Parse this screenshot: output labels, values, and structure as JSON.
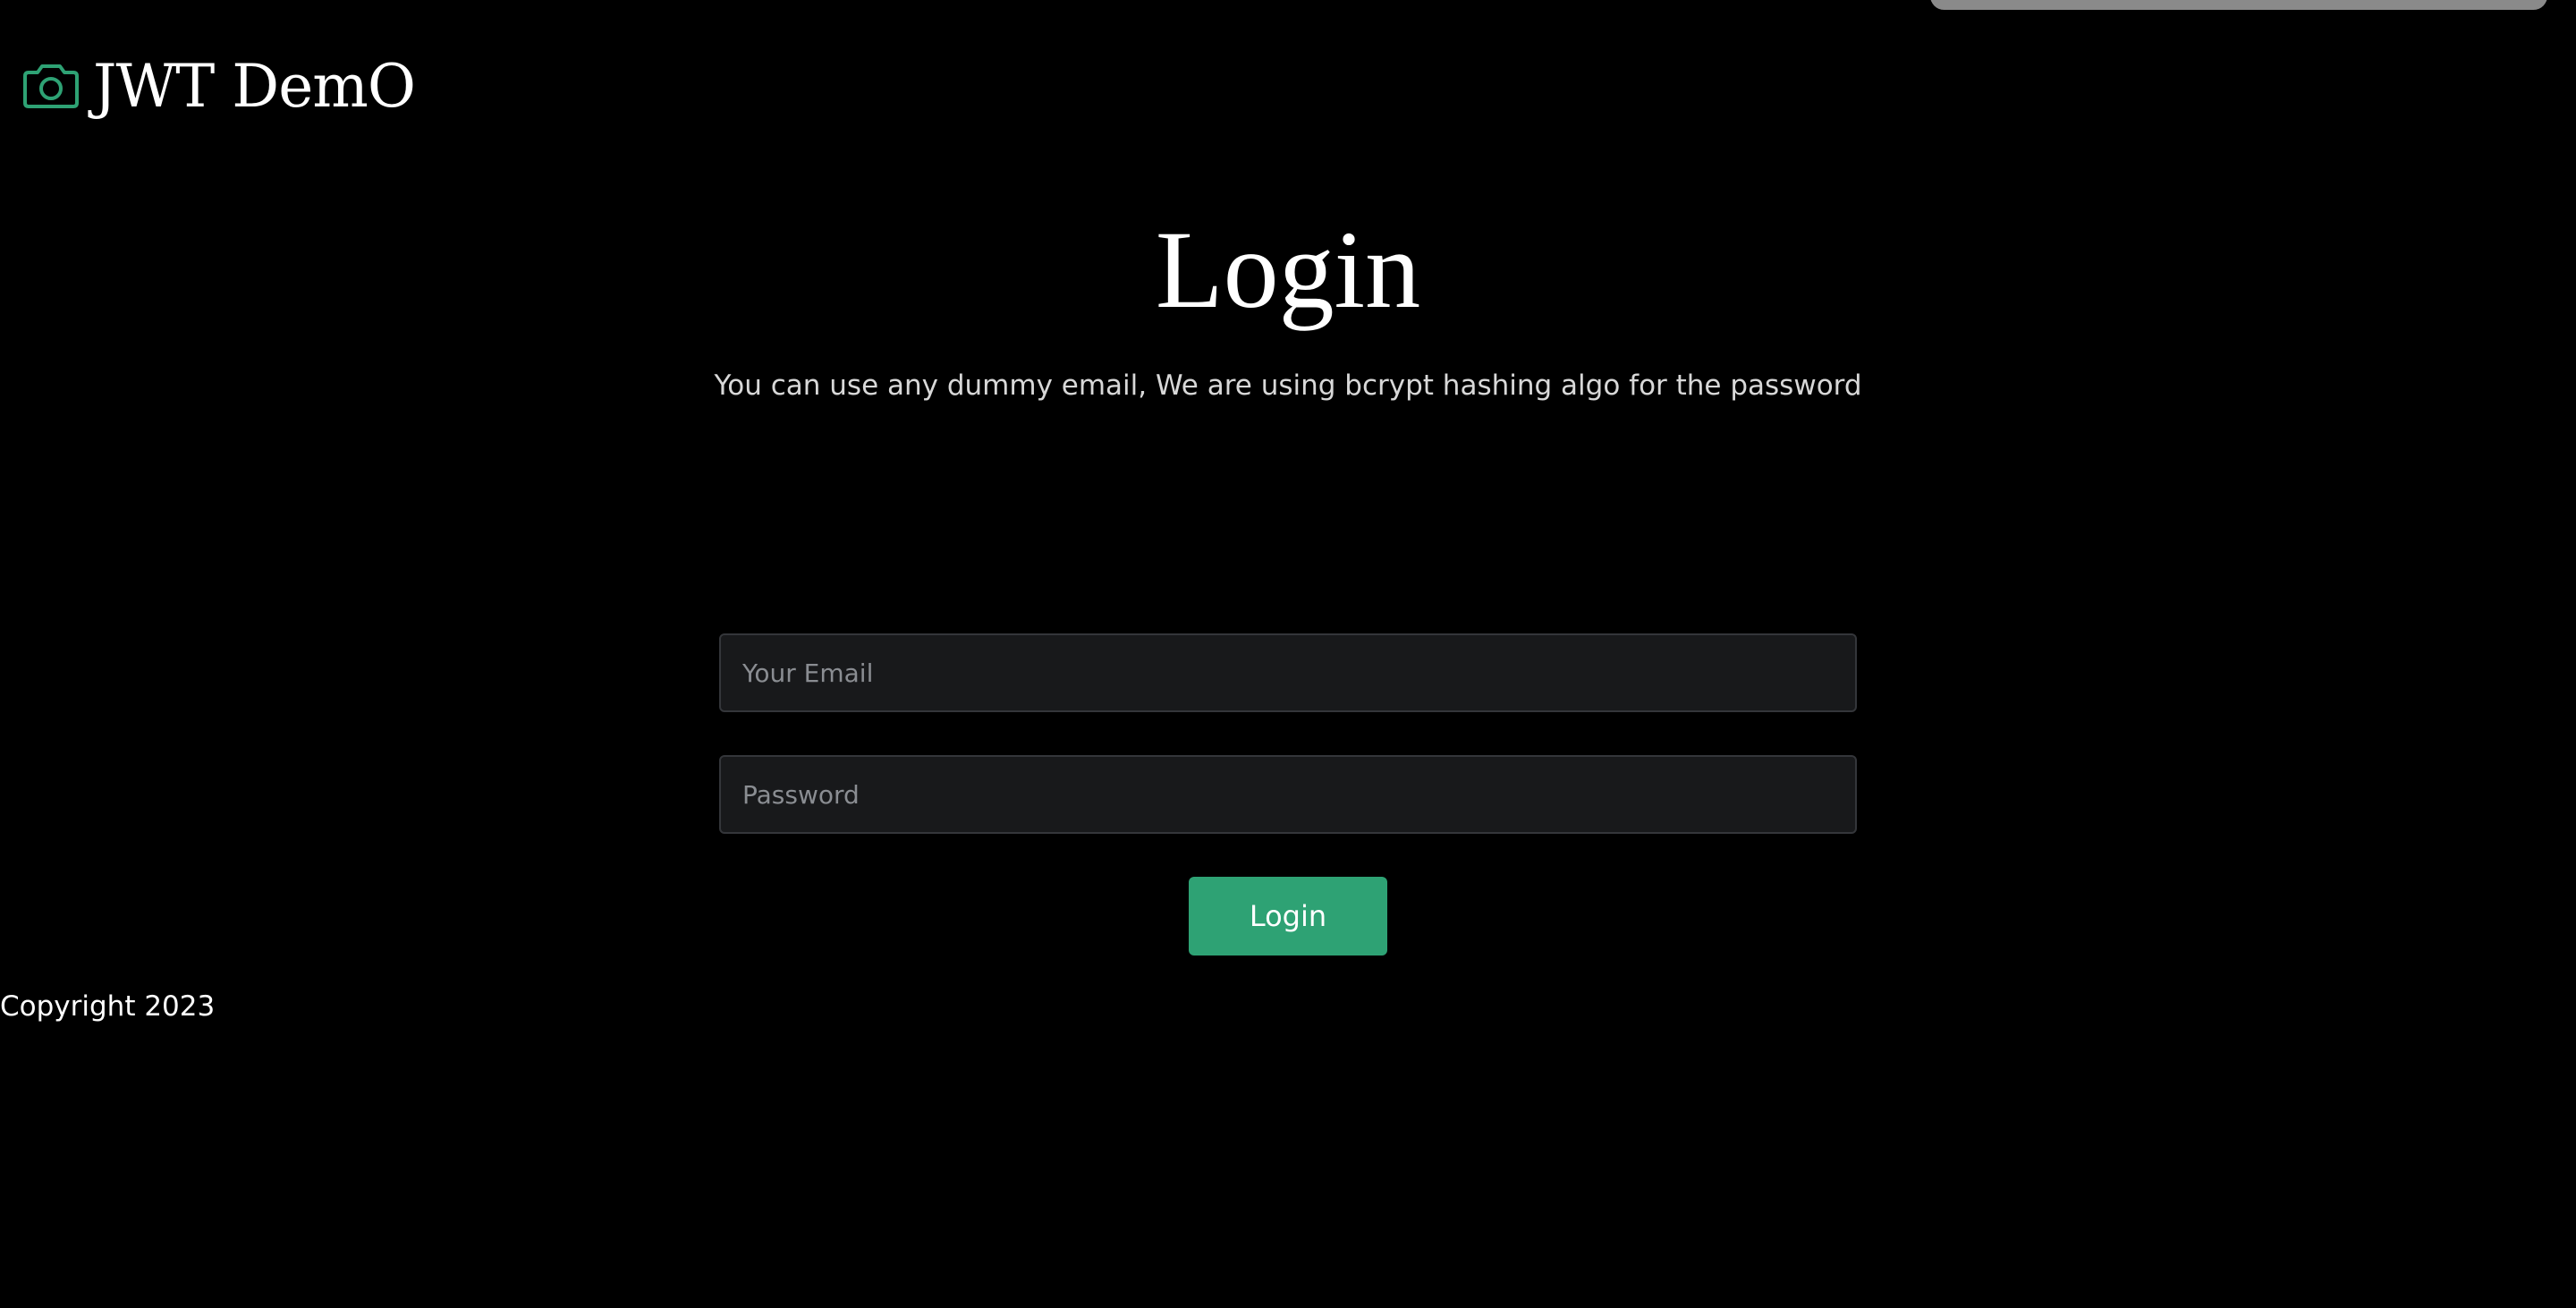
{
  "header": {
    "brand_name": "JWT DemO",
    "brand_icon": "camera-icon",
    "accent_color": "#2ea274"
  },
  "main": {
    "title": "Login",
    "subtitle": "You can use any dummy email, We are using bcrypt hashing algo for the password",
    "form": {
      "email": {
        "value": "",
        "placeholder": "Your Email"
      },
      "password": {
        "value": "",
        "placeholder": "Password"
      },
      "submit_label": "Login"
    }
  },
  "footer": {
    "copyright": "Copyright 2023"
  }
}
